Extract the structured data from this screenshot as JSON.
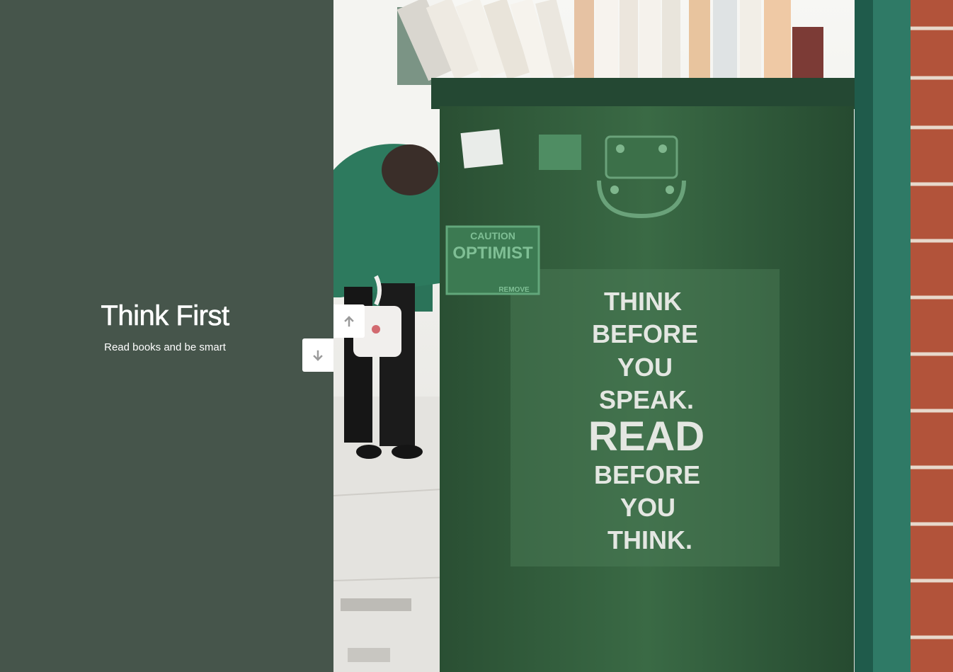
{
  "slide": {
    "title": "Think First",
    "subtitle": "Read books and be smart"
  },
  "photo": {
    "stencil_lines": [
      "THINK",
      "BEFORE",
      "YOU",
      "SPEAK.",
      "READ",
      "BEFORE",
      "YOU",
      "THINK."
    ],
    "sticker_lines": [
      "CAUTION",
      "OPTIMIST",
      "REMOVE"
    ]
  },
  "navigation": {
    "up_icon": "arrow-up-icon",
    "down_icon": "arrow-down-icon"
  },
  "colors": {
    "panel_background": "#46554b",
    "box_green": "#2f5a3a",
    "button_background": "#ffffff",
    "arrow_color": "#9a9a9a"
  }
}
